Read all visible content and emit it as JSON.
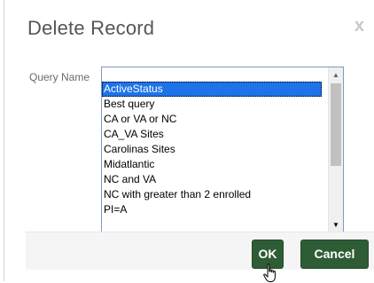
{
  "dialog": {
    "title": "Delete Record",
    "close_label": "x"
  },
  "form": {
    "query_name_label": "Query Name",
    "options": [
      "",
      "ActiveStatus",
      "Best query",
      "CA or VA or NC",
      "CA_VA Sites",
      "Carolinas Sites",
      "Midatlantic",
      "NC and VA",
      "NC with greater than 2 enrolled",
      "PI=A"
    ],
    "selected": "ActiveStatus"
  },
  "buttons": {
    "ok_label": "OK",
    "cancel_label": "Cancel"
  },
  "icons": {
    "close": "close-icon",
    "cursor": "hand-pointer-icon",
    "scroll_up": "scroll-up-arrow-icon",
    "scroll_down": "scroll-down-arrow-icon"
  },
  "colors": {
    "selection": "#1e73e8",
    "button_bg": "#2e5d35"
  }
}
